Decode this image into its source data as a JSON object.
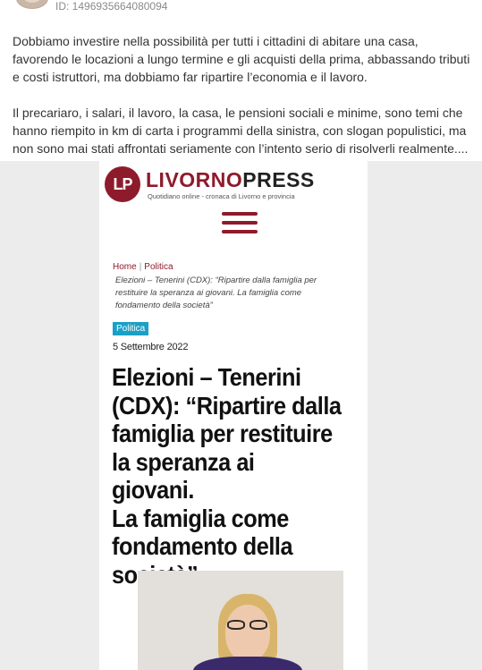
{
  "post": {
    "id_label": "ID: 1496935664080094",
    "paragraphs": [
      "Dobbiamo investire nella possibilità per tutti i cittadini di abitare una casa, favorendo le locazioni a lungo termine e gli acquisti della prima, abbassando tributi e costi istruttori, ma dobbiamo far ripartire l’economia e il lavoro.",
      "Il precariaro, i salari, il lavoro, la casa, le pensioni sociali e minime, sono temi che hanno riempito in km di carta i programmi della sinistra, con slogan populistici, ma non sono mai stati affrontati seriamente con l’intento serio di risolverli realmente...."
    ]
  },
  "article": {
    "logo_initials": "LP",
    "logo_name_a": "LIVORNO",
    "logo_name_b": "PRESS",
    "logo_tagline": "Quotidiano online - cronaca di Livorno e provincia",
    "breadcrumb": [
      "Home",
      "Politica"
    ],
    "breadcrumb_current": "Elezioni – Tenerini (CDX): “Ripartire dalla famiglia per restituire la speranza ai giovani. La famiglia come fondamento della società”",
    "category": "Politica",
    "date": "5 Settembre 2022",
    "headline_lines": [
      "Elezioni – Tenerini",
      "(CDX): “Ripartire dalla",
      "famiglia per restituire",
      "la speranza ai giovani.",
      "La famiglia come",
      "fondamento della",
      "società”"
    ]
  },
  "colors": {
    "brand": "#8e1b2b",
    "category_badge": "#1aa0c6"
  }
}
